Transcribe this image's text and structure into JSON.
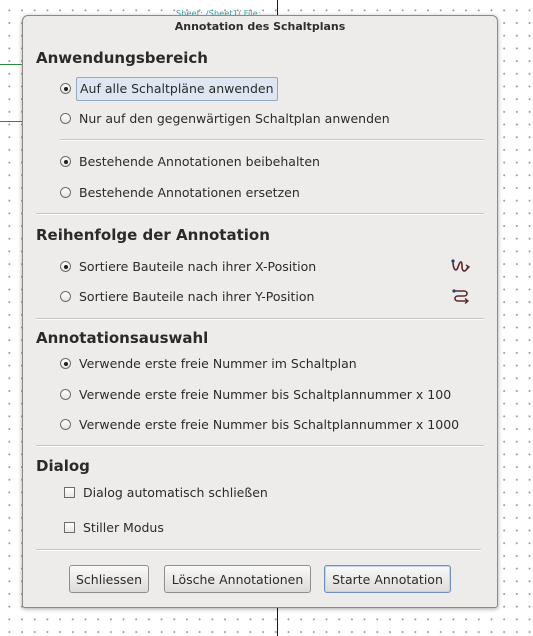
{
  "background": {
    "schematic_text": "Sheet: /Sheet1/ File: ..."
  },
  "dialog": {
    "title": "Annotation des Schaltplans",
    "sections": {
      "scope": {
        "title": "Anwendungsbereich",
        "options": [
          {
            "label": "Auf alle Schaltpläne anwenden",
            "checked": true
          },
          {
            "label": "Nur auf den gegenwärtigen Schaltplan anwenden",
            "checked": false
          }
        ],
        "options2": [
          {
            "label": "Bestehende Annotationen beibehalten",
            "checked": true
          },
          {
            "label": "Bestehende Annotationen ersetzen",
            "checked": false
          }
        ]
      },
      "order": {
        "title": "Reihenfolge der Annotation",
        "options": [
          {
            "label": "Sortiere Bauteile nach ihrer X-Position",
            "checked": true,
            "icon": "sort-by-x-icon"
          },
          {
            "label": "Sortiere Bauteile nach ihrer Y-Position",
            "checked": false,
            "icon": "sort-by-y-icon"
          }
        ]
      },
      "selection": {
        "title": "Annotationsauswahl",
        "options": [
          {
            "label": "Verwende erste freie Nummer im Schaltplan",
            "checked": true
          },
          {
            "label": "Verwende erste freie Nummer bis Schaltplannummer x 100",
            "checked": false
          },
          {
            "label": "Verwende erste freie Nummer bis Schaltplannummer x 1000",
            "checked": false
          }
        ]
      },
      "dialog": {
        "title": "Dialog",
        "checkboxes": [
          {
            "label": "Dialog automatisch schließen",
            "checked": false
          },
          {
            "label": "Stiller Modus",
            "checked": false
          }
        ]
      }
    },
    "buttons": {
      "close": "Schliessen",
      "clear": "Lösche Annotationen",
      "start": "Starte Annotation"
    }
  },
  "colors": {
    "dialog_bg": "#edecea",
    "wire": "#2e8b3e",
    "focus": "#93a9c6"
  }
}
